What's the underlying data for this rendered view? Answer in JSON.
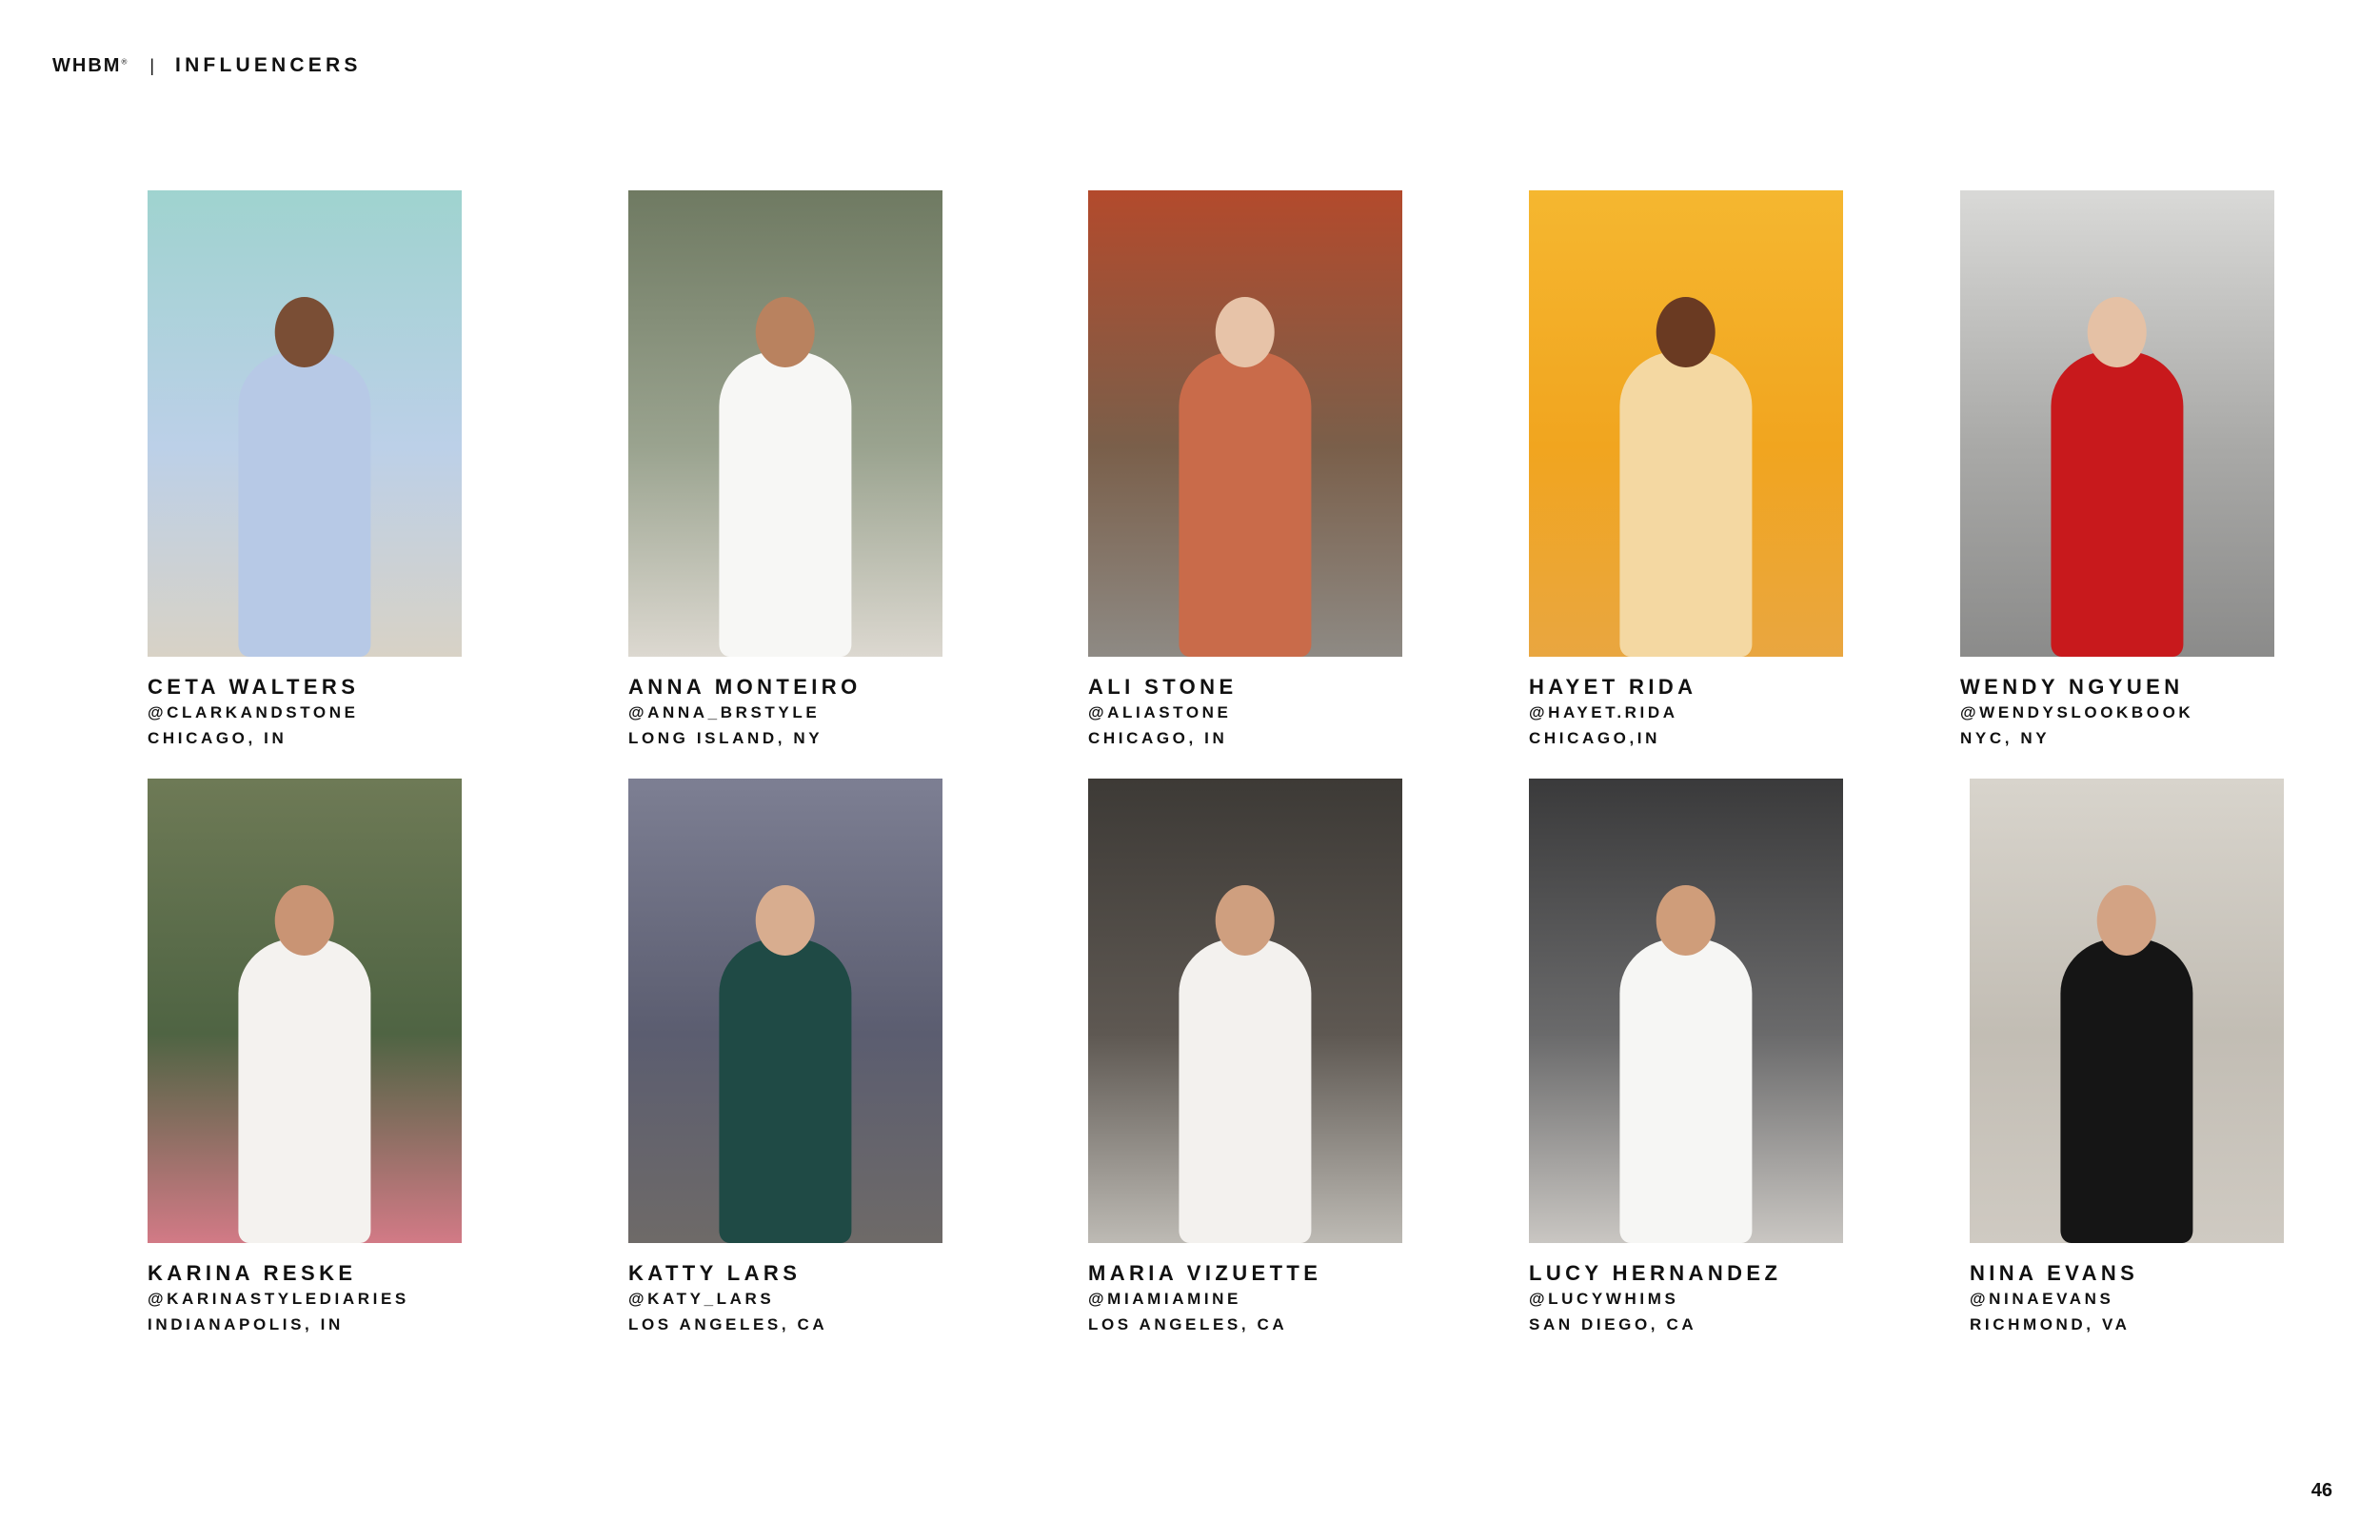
{
  "header": {
    "brand": "WHBM",
    "brand_mark": "®",
    "separator": "|",
    "section": "INFLUENCERS"
  },
  "influencers": [
    {
      "name": "CETA WALTERS",
      "handle": "@CLARKANDSTONE",
      "location": "CHICAGO, IN",
      "colors": [
        "#9fd3cf",
        "#bcd0e8",
        "#d8d2c6"
      ],
      "outfit": "#b7c9e6",
      "skin": "#7a4e35"
    },
    {
      "name": "ANNA MONTEIRO",
      "handle": "@ANNA_BRSTYLE",
      "location": "LONG ISLAND, NY",
      "colors": [
        "#6f7a62",
        "#9aa38f",
        "#dcd8d0"
      ],
      "outfit": "#f7f7f5",
      "skin": "#b9825f"
    },
    {
      "name": "ALI STONE",
      "handle": "@ALIASTONE",
      "location": "CHICAGO, IN",
      "colors": [
        "#b34a2c",
        "#7a5f4a",
        "#8e8a84"
      ],
      "outfit": "#c96b4a",
      "skin": "#e7c3a8"
    },
    {
      "name": "HAYET RIDA",
      "handle": "@HAYET.RIDA",
      "location": "CHICAGO,IN",
      "colors": [
        "#f5b730",
        "#f1a51f",
        "#e9a640"
      ],
      "outfit": "#f4d8a2",
      "skin": "#6a3a22"
    },
    {
      "name": "WENDY NGYUEN",
      "handle": "@WENDYSLOOKBOOK",
      "location": "NYC, NY",
      "colors": [
        "#d9d9d7",
        "#a9a9a7",
        "#8b8b8a"
      ],
      "outfit": "#c8191c",
      "skin": "#e5c1a5"
    },
    {
      "name": "KARINA RESKE",
      "handle": "@KARINASTYLEDIARIES",
      "location": "INDIANAPOLIS, IN",
      "colors": [
        "#6e7a56",
        "#4f6443",
        "#d27a86"
      ],
      "outfit": "#f4f2ef",
      "skin": "#c99474"
    },
    {
      "name": "KATTY LARS",
      "handle": "@KATY_LARS",
      "location": "LOS ANGELES, CA",
      "colors": [
        "#7d7f93",
        "#5b5d70",
        "#6e6a68"
      ],
      "outfit": "#1f4a45",
      "skin": "#d8ad8f"
    },
    {
      "name": "MARIA VIZUETTE",
      "handle": "@MIAMIAMINE",
      "location": "LOS ANGELES, CA",
      "colors": [
        "#3d3a36",
        "#5e5852",
        "#bdbab4"
      ],
      "outfit": "#f3f1ee",
      "skin": "#cf9f7f"
    },
    {
      "name": "LUCY HERNANDEZ",
      "handle": "@LUCYWHIMS",
      "location": "SAN DIEGO, CA",
      "colors": [
        "#3a3a3b",
        "#6a6a6b",
        "#c9c6c2"
      ],
      "outfit": "#f6f6f4",
      "skin": "#cf9d7a"
    },
    {
      "name": "NINA EVANS",
      "handle": "@NINAEVANS",
      "location": "RICHMOND, VA",
      "colors": [
        "#d8d4cc",
        "#c2bdb4",
        "#cfcac2"
      ],
      "outfit": "#151515",
      "skin": "#d3a384"
    }
  ],
  "page_number": "46"
}
